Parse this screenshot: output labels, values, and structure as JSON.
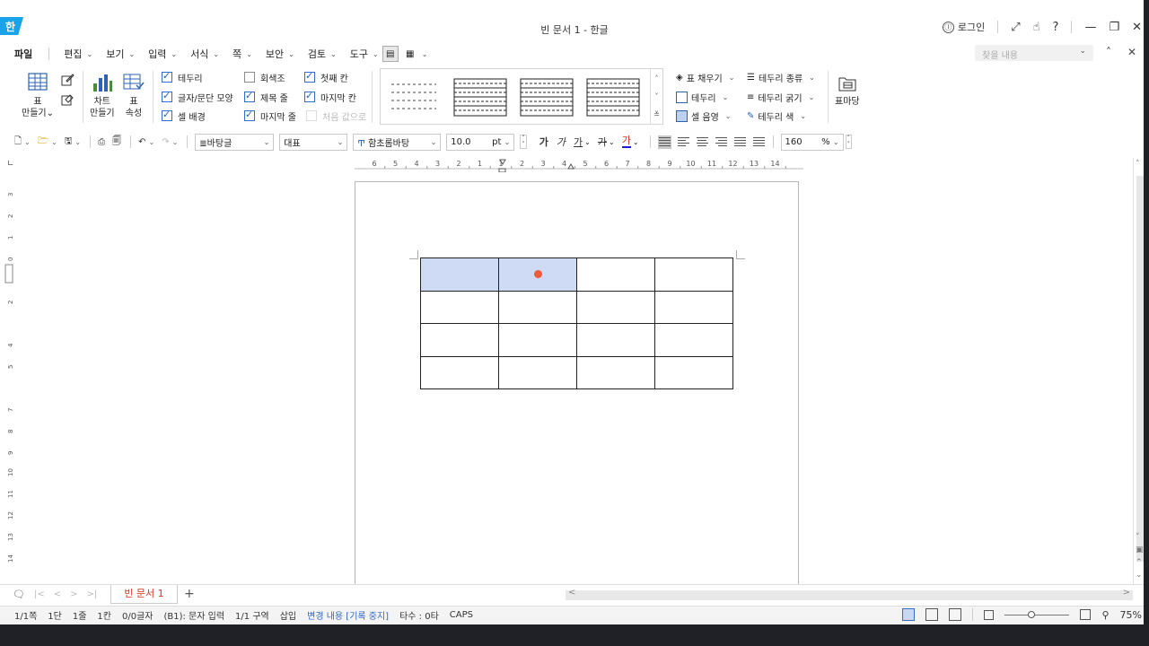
{
  "titlebar": {
    "app_logo": "한",
    "title": "빈 문서 1 - 한글",
    "login": "로그인",
    "login_icon": "ⓛ"
  },
  "menubar": {
    "file": "파일",
    "items": [
      {
        "label": "편집"
      },
      {
        "label": "보기"
      },
      {
        "label": "입력"
      },
      {
        "label": "서식"
      },
      {
        "label": "쪽"
      },
      {
        "label": "보안"
      },
      {
        "label": "검토"
      },
      {
        "label": "도구"
      }
    ],
    "search_placeholder": "찾을 내용"
  },
  "ribbon": {
    "make_table_label": "표\n만들기",
    "make_table_line1": "표",
    "make_table_line2": "만들기",
    "chart_line1": "차트",
    "chart_line2": "만들기",
    "table_props_line1": "표",
    "table_props_line2": "속성",
    "checks": [
      {
        "label": "테두리",
        "checked": true
      },
      {
        "label": "글자/문단 모양",
        "checked": true
      },
      {
        "label": "셀 배경",
        "checked": true
      },
      {
        "label": "회색조",
        "checked": false
      },
      {
        "label": "제목 줄",
        "checked": true
      },
      {
        "label": "마지막 줄",
        "checked": true
      },
      {
        "label": "첫째 칸",
        "checked": true
      },
      {
        "label": "마지막 칸",
        "checked": true
      },
      {
        "label": "처음 값으로",
        "checked": false,
        "disabled": true
      }
    ],
    "right_items": {
      "fill": "표 채우기",
      "border": "테두리",
      "shade": "셀 음영",
      "border_type": "테두리 종류",
      "border_width": "테두리 굵기",
      "border_color": "테두리 색",
      "table_yard": "표마당"
    }
  },
  "toolbar": {
    "style": "바탕글",
    "representative": "대표",
    "font": "함초롬바탕",
    "size": "10.0",
    "size_unit": "pt",
    "bold": "가",
    "italic": "가",
    "underline": "가",
    "strike": "가",
    "color": "가",
    "zoom": "160",
    "zoom_unit": "%"
  },
  "ruler": {
    "ticks": [
      "6",
      "5",
      "4",
      "3",
      "2",
      "1",
      "1",
      "2",
      "3",
      "4",
      "5",
      "6",
      "7",
      "8",
      "9",
      "10",
      "11",
      "12",
      "13",
      "14"
    ]
  },
  "tabbar": {
    "doc_tab": "빈 문서 1",
    "add": "+"
  },
  "statusbar": {
    "page": "1/1쪽",
    "column": "1단",
    "line": "1줄",
    "col": "1칸",
    "chars": "0/0글자",
    "cell": "(B1): 문자 입력",
    "section": "1/1 구역",
    "insert": "삽입",
    "track": "변경 내용 [기록 중지]",
    "typing": "타수 : 0타",
    "caps": "CAPS",
    "zoom": "75%"
  },
  "colors": {
    "selected_cell": "#cfdaf4",
    "cursor_dot": "#ef5a3a",
    "app_blue": "#1aa3e8",
    "tab_red": "#d9341c",
    "status_blue": "#2f67c9"
  },
  "document_table": {
    "rows": 4,
    "cols": 4,
    "selected_cells": [
      "A1",
      "B1"
    ],
    "current_cell": "B1"
  }
}
